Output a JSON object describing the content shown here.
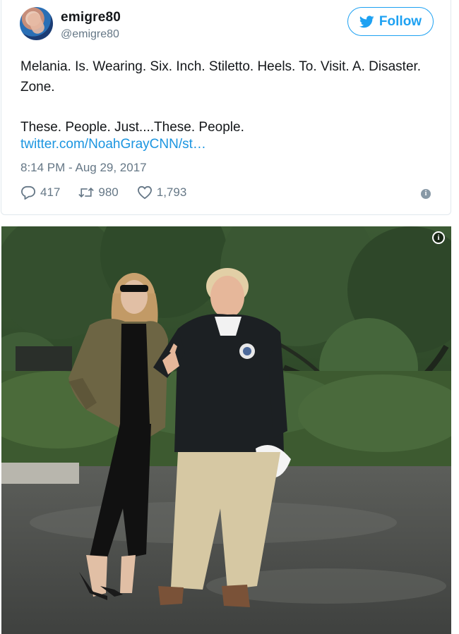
{
  "author": {
    "display_name": "emigre80",
    "handle": "@emigre80"
  },
  "follow_button": {
    "label": "Follow",
    "icon": "twitter-bird-icon"
  },
  "tweet": {
    "line1": "Melania. Is. Wearing. Six. Inch. Stiletto. Heels. To. Visit. A. Disaster. Zone.",
    "line2": "These. People. Just....These. People.",
    "link": "twitter.com/NoahGrayCNN/st…",
    "timestamp": "8:14 PM - Aug 29, 2017"
  },
  "stats": {
    "replies": "417",
    "retweets": "980",
    "likes": "1,793"
  },
  "colors": {
    "accent": "#1da1f2",
    "link": "#1b95e0",
    "muted": "#657786",
    "border": "#e1e8ed"
  },
  "media": {
    "info_icon": "info-icon"
  }
}
